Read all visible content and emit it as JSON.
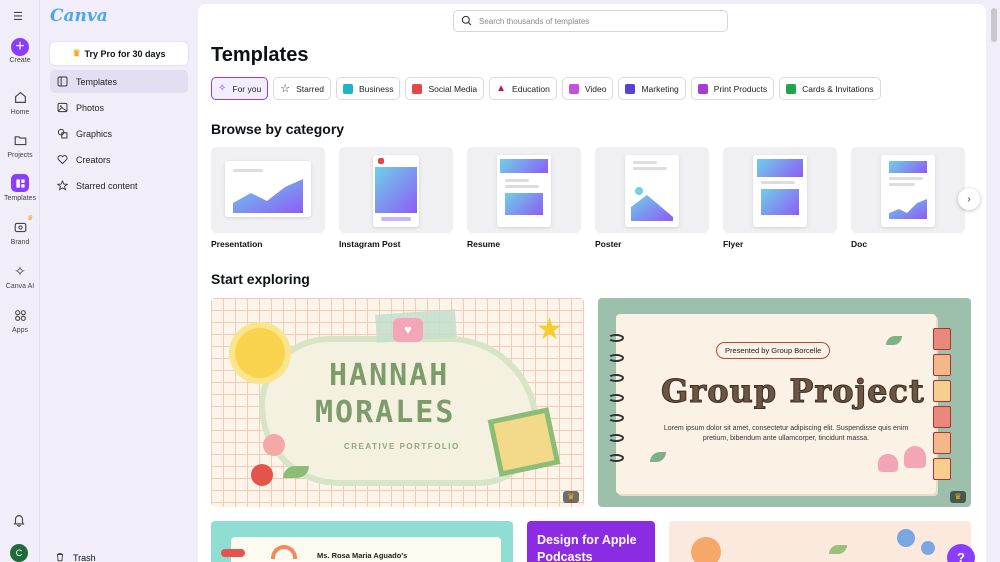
{
  "brand": {
    "logo": "Canva",
    "accent": "#8b3dff"
  },
  "rail": {
    "items": [
      {
        "label": "Create",
        "icon": "plus-icon"
      },
      {
        "label": "Home",
        "icon": "home-icon"
      },
      {
        "label": "Projects",
        "icon": "folder-icon"
      },
      {
        "label": "Templates",
        "icon": "templates-icon",
        "active": true
      },
      {
        "label": "Brand",
        "icon": "brand-icon"
      },
      {
        "label": "Canva AI",
        "icon": "sparkle-icon"
      },
      {
        "label": "Apps",
        "icon": "apps-icon"
      }
    ],
    "avatar_initial": "C"
  },
  "panel": {
    "try_pro": "Try Pro for 30 days",
    "items": [
      {
        "label": "Templates",
        "icon": "templates-icon",
        "active": true
      },
      {
        "label": "Photos",
        "icon": "photo-icon"
      },
      {
        "label": "Graphics",
        "icon": "graphics-icon"
      },
      {
        "label": "Creators",
        "icon": "heart-icon"
      },
      {
        "label": "Starred content",
        "icon": "star-icon"
      }
    ],
    "trash": "Trash"
  },
  "search": {
    "placeholder": "Search thousands of templates",
    "value": ""
  },
  "main": {
    "title": "Templates",
    "chips": [
      {
        "label": "For you",
        "icon": "sparkle-icon",
        "color": "#8b3dff",
        "active": true
      },
      {
        "label": "Starred",
        "icon": "star-icon",
        "color": "#222222"
      },
      {
        "label": "Business",
        "icon": "business-icon",
        "color": "#1fb5c7"
      },
      {
        "label": "Social Media",
        "icon": "social-heart-icon",
        "color": "#e8454a"
      },
      {
        "label": "Education",
        "icon": "graduation-cap-icon",
        "color": "#b5166b"
      },
      {
        "label": "Video",
        "icon": "video-icon",
        "color": "#c84ee0"
      },
      {
        "label": "Marketing",
        "icon": "megaphone-icon",
        "color": "#5b3fd9"
      },
      {
        "label": "Print Products",
        "icon": "printer-icon",
        "color": "#a93ad6"
      },
      {
        "label": "Cards & Invitations",
        "icon": "card-icon",
        "color": "#1fa64c"
      }
    ],
    "browse_heading": "Browse by category",
    "categories": [
      {
        "label": "Presentation"
      },
      {
        "label": "Instagram Post"
      },
      {
        "label": "Resume"
      },
      {
        "label": "Poster"
      },
      {
        "label": "Flyer"
      },
      {
        "label": "Doc"
      }
    ],
    "explore_heading": "Start exploring",
    "explore": [
      {
        "line1": "HANNAH",
        "line2": "MORALES",
        "subtitle": "CREATIVE PORTFOLIO"
      },
      {
        "presented": "Presented by Group Borcelle",
        "title": "Group Project",
        "body": "Lorem ipsum dolor sit amet, consectetur adipiscing elit. Suspendisse quis enim pretium, bibendum ante ullamcorper, tincidunt massa."
      }
    ],
    "bottom": [
      {
        "teacher": "Ms. Rosa Maria Aguado's"
      },
      {
        "title": "Design for Apple Podcasts"
      },
      {}
    ]
  },
  "help_label": "?"
}
